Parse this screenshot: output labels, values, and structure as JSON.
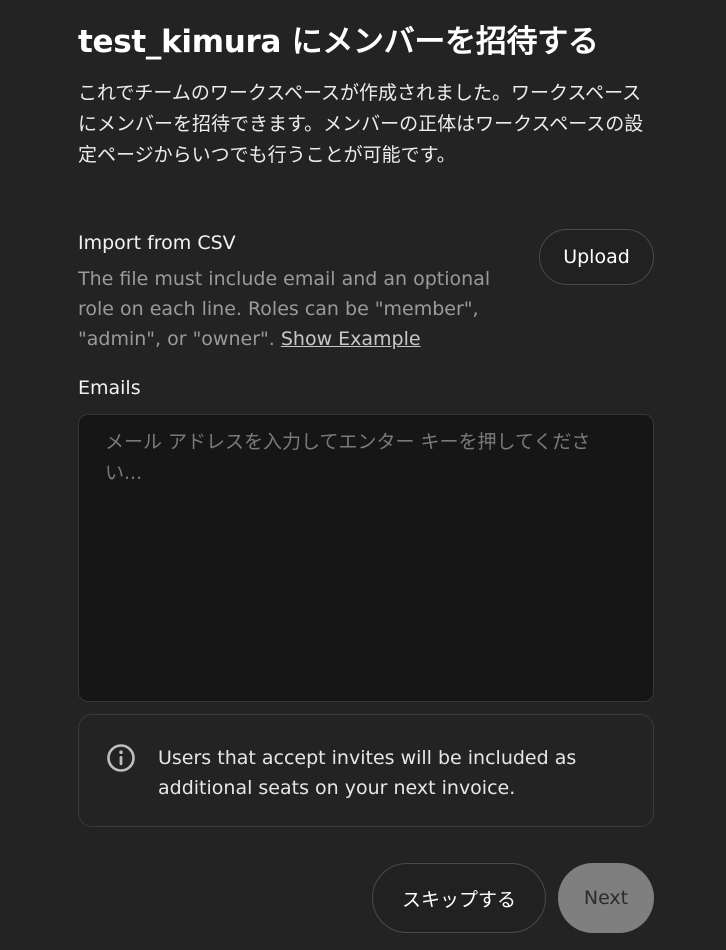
{
  "header": {
    "title": "test_kimura にメンバーを招待する",
    "description": "これでチームのワークスペースが作成されました。ワークスペースにメンバーを招待できます。メンバーの正体はワークスペースの設定ページからいつでも行うことが可能です。"
  },
  "csv_import": {
    "title": "Import from CSV",
    "help_text": "The file must include email and an optional role on each line. Roles can be \"member\", \"admin\", or \"owner\". ",
    "example_link": "Show Example",
    "upload_label": "Upload"
  },
  "emails": {
    "label": "Emails",
    "value": "",
    "placeholder": "メール アドレスを入力してエンター キーを押してください..."
  },
  "notice": {
    "icon": "info-circle-icon",
    "text": "Users that accept invites will be included as additional seats on your next invoice."
  },
  "actions": {
    "skip_label": "スキップする",
    "next_label": "Next"
  },
  "colors": {
    "background": "#232323",
    "input_background": "#161616",
    "disabled_button": "#7f7f7f"
  }
}
